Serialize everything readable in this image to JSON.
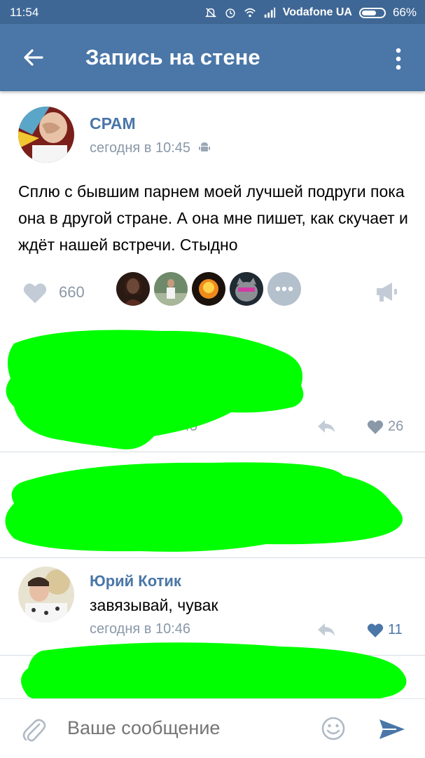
{
  "status_bar": {
    "time": "11:54",
    "carrier": "Vodafone UA",
    "battery": "66%",
    "battery_level": 0.66
  },
  "toolbar": {
    "title": "Запись на стене",
    "back_icon": "arrow-left-icon",
    "menu_icon": "more-vertical-icon"
  },
  "post": {
    "author": "СРАМ",
    "time": "сегодня в 10:45",
    "platform_icon": "android-icon",
    "text": "Сплю с бывшим парнем моей лучшей подруги пока она в другой стране. А она мне пишет, как скучает и ждёт нашей встречи. Стыдно",
    "likes": "660"
  },
  "comments": [
    {
      "redacted": true,
      "time": "10:45",
      "likes": "26"
    },
    {
      "redacted": true
    },
    {
      "author": "Юрий Котик",
      "text": "завязывай, чувак",
      "time": "сегодня в 10:46",
      "likes": "11",
      "liked": true
    },
    {
      "redacted": true
    }
  ],
  "composer": {
    "placeholder": "Ваше сообщение"
  },
  "colors": {
    "header": "#4a76a8",
    "status_bar": "#3f6795",
    "link": "#4a76a8",
    "muted": "#8a98a8",
    "redaction": "#00ff00"
  }
}
